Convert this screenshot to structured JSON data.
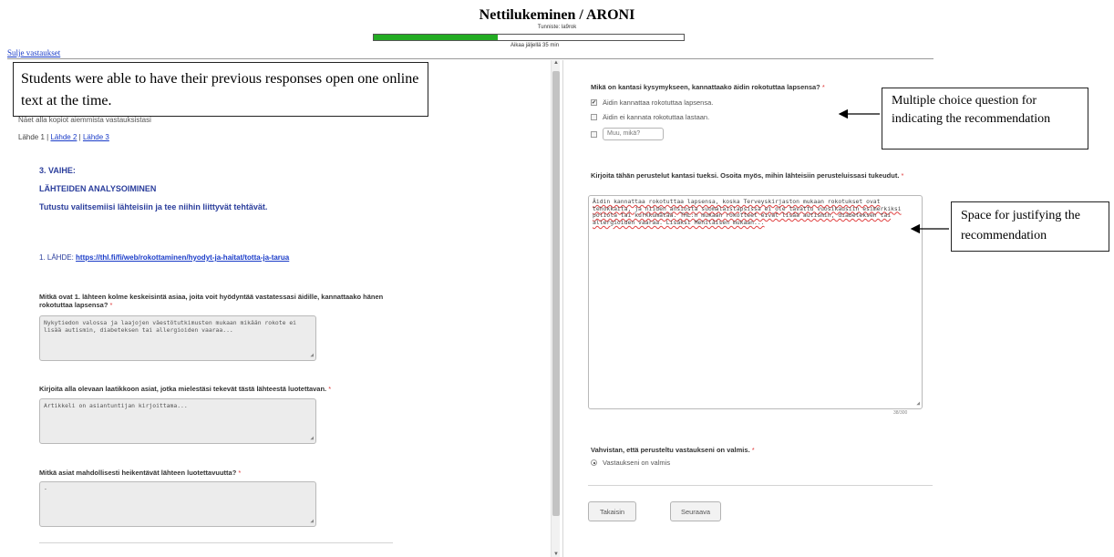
{
  "header": {
    "app_title": "Nettilukeminen / ARONI",
    "user_id": "Tunniste: la9rok",
    "progress_fraction": 0.4,
    "time_left": "Aikaa jäljellä 35 min",
    "close_answers_link": "Sulje vastaukset",
    "colors": {
      "progress": "#23ac23",
      "link": "#1a3cc8",
      "heading": "#2b3e9c",
      "required": "#e03a3a"
    }
  },
  "annotations": {
    "left_note": "Students were able to have their previous responses open one online text at the time.",
    "multiple_choice_note": "Multiple choice question for indicating the recommendation",
    "justify_note": "Space for justifying the recommendation"
  },
  "left": {
    "intro": "Näet alla kopiot aiemmista vastauksistasi",
    "sources": {
      "current": "Lähde 1",
      "separator": "|",
      "link_2": "Lähde 2",
      "link_3": "Lähde 3"
    },
    "phase": "3. VAIHE:",
    "phase_title": "LÄHTEIDEN ANALYSOIMINEN",
    "phase_instruction": "Tutustu valitsemiisi lähteisiin ja tee niihin liittyvät tehtävät.",
    "source_prefix": "1. LÄHDE:",
    "source_url": "https://thl.fi/fi/web/rokottaminen/hyodyt-ja-haitat/totta-ja-tarua",
    "questions": [
      {
        "label": "Mitkä ovat 1. lähteen kolme keskeisintä asiaa, joita voit hyödyntää vastatessasi äidille, kannattaako hänen rokotuttaa lapsensa?",
        "required": "*",
        "answer": "Nykytiedon valossa ja laajojen väestötutkimusten mukaan mikään rokote ei lisää autismin, diabeteksen tai allergioiden vaaraa..."
      },
      {
        "label": "Kirjoita alla olevaan laatikkoon asiat, jotka mielestäsi tekevät tästä lähteestä luotettavan.",
        "required": "*",
        "answer": "Artikkeli on asiantuntijan kirjoittama..."
      },
      {
        "label": "Mitkä asiat mahdollisesti heikentävät lähteen luotettavuutta?",
        "required": "*",
        "answer": "-"
      }
    ],
    "scroll": {
      "up": "▲",
      "down": "▼"
    }
  },
  "right": {
    "mc_question": "Mikä on kantasi kysymykseen, kannattaako äidin rokotuttaa lapsensa?",
    "mc_required": "*",
    "options": [
      {
        "label": "Äidin kannattaa rokotuttaa lapsensa.",
        "checked": true
      },
      {
        "label": "Äidin ei kannata rokotuttaa lastaan.",
        "checked": false
      }
    ],
    "other_placeholder": "Muu, mikä?",
    "justify_question": "Kirjoita tähän perustelut kantasi tueksi. Osoita myös, mihin lähteisiin perusteluissasi tukeudut.",
    "justify_required": "*",
    "justify_text": "Äidin kannattaa rokotuttaa lapsensa, koska Terveyskirjaston mukaan rokotukset ovat tehokkaita, ja niiden ansiosta suomalaislapsissa ei ole tavattu vuosikausiin esimerkiksi poliota tai kurkkumätää. THL:n mukaan rokotteet eivät lisää autismin, diabeteksen tai allergioiden vaaraa. Lisäksi Mehiläisen mukaan...",
    "char_count": "38/300",
    "confirm_question": "Vahvistan, että perusteltu vastaukseni on valmis.",
    "confirm_required": "*",
    "confirm_option": "Vastaukseni on valmis",
    "back_button": "Takaisin",
    "next_button": "Seuraava"
  }
}
